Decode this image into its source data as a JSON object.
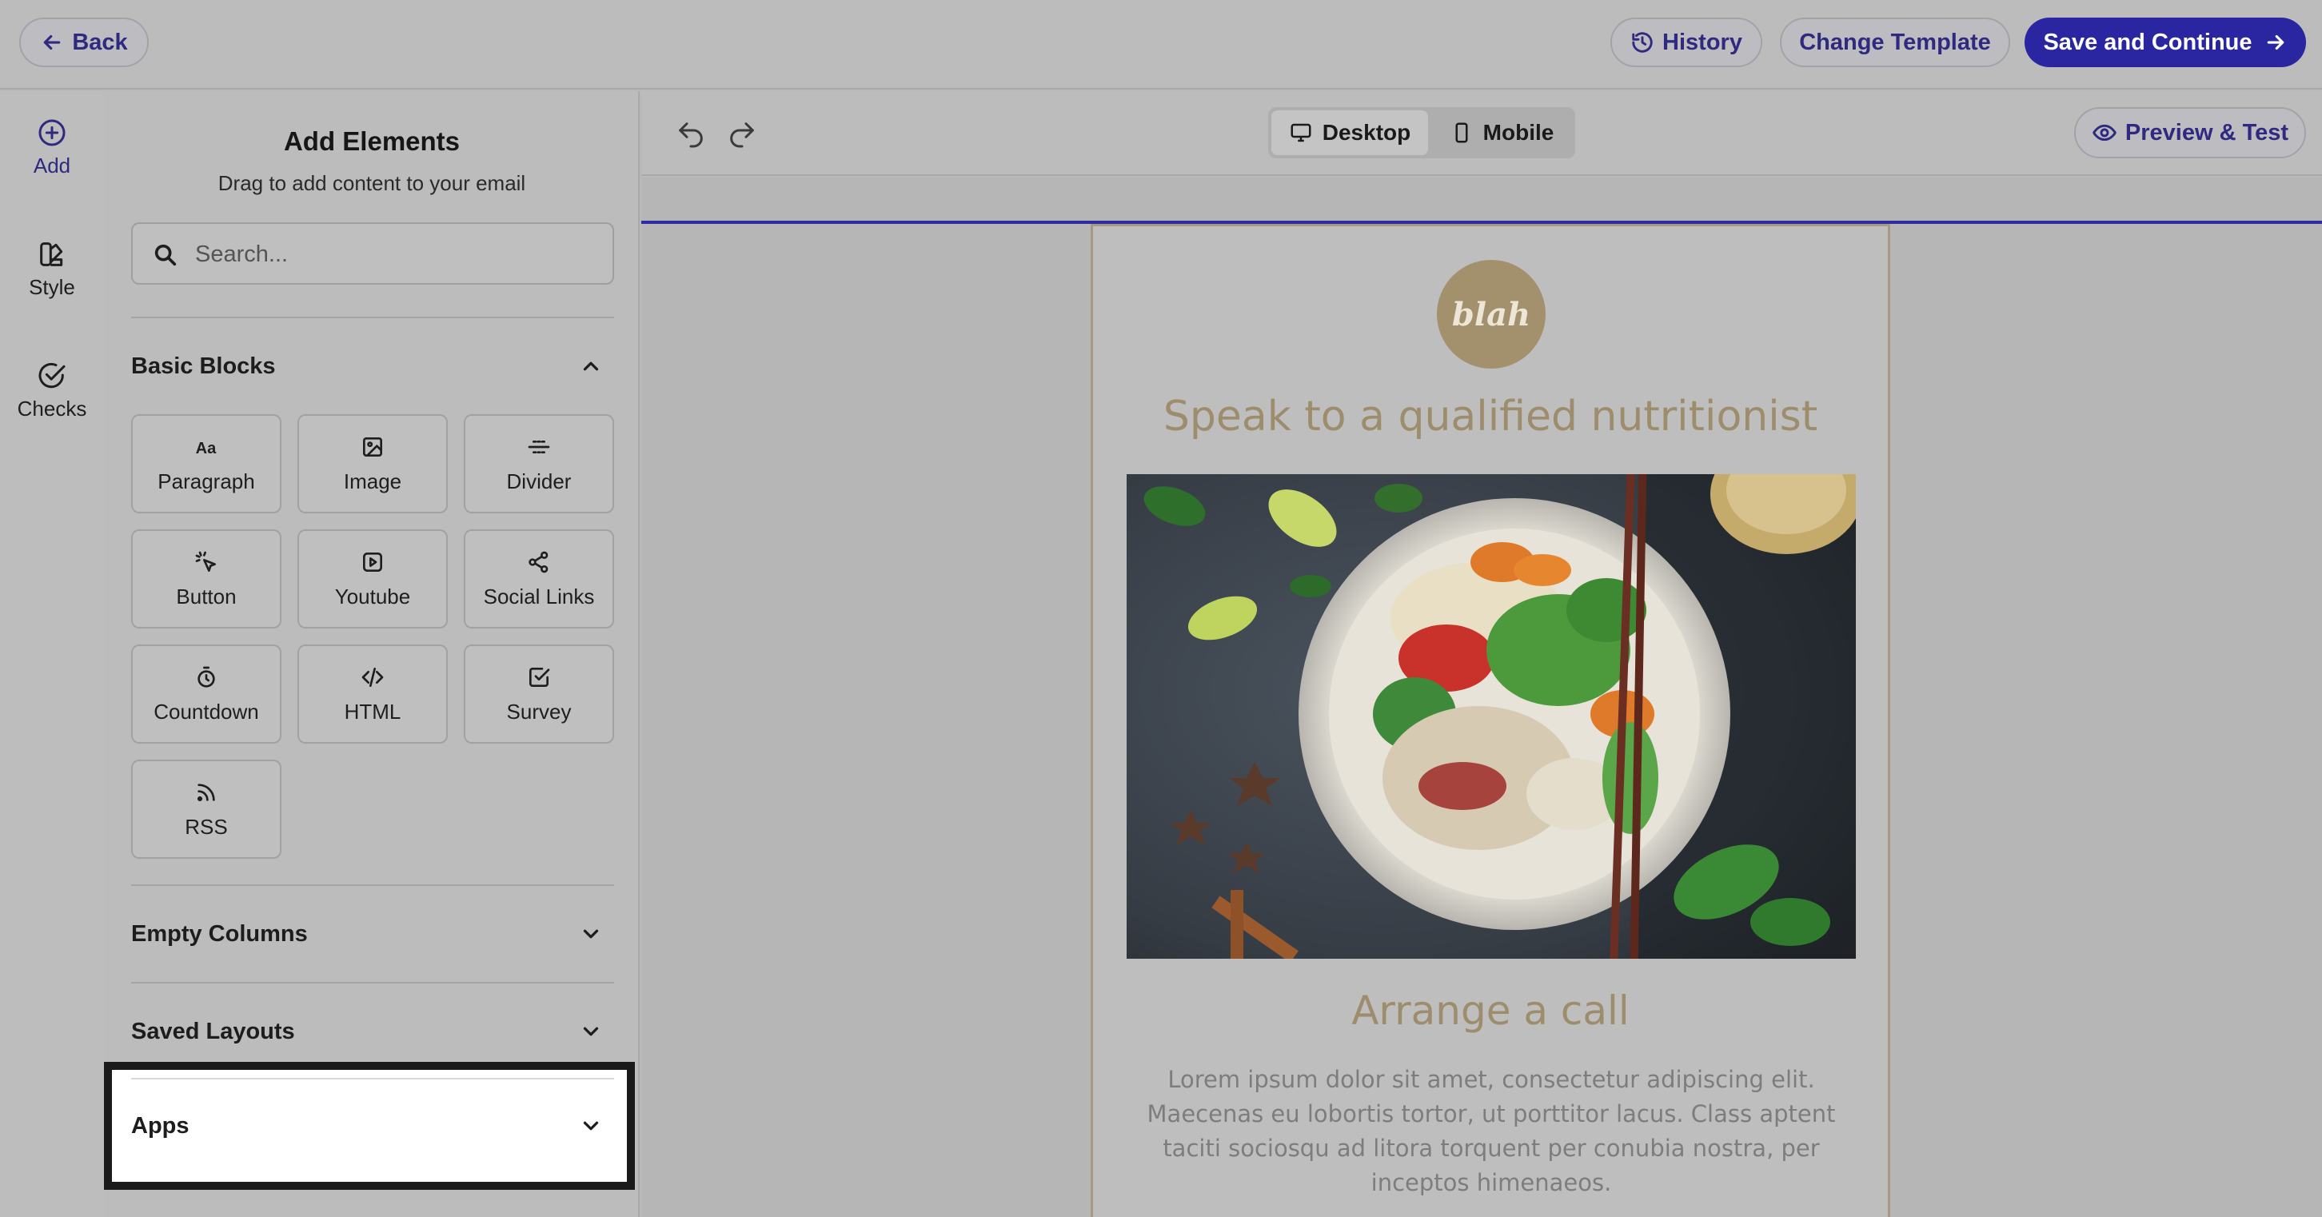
{
  "topbar": {
    "back_label": "Back",
    "history_label": "History",
    "change_template_label": "Change Template",
    "save_continue_label": "Save and Continue"
  },
  "rail": {
    "items": [
      {
        "label": "Add",
        "icon": "plus-circle-icon"
      },
      {
        "label": "Style",
        "icon": "palette-icon"
      },
      {
        "label": "Checks",
        "icon": "check-circle-icon"
      }
    ]
  },
  "panel": {
    "title": "Add Elements",
    "subtitle": "Drag to add content to your email",
    "search_placeholder": "Search...",
    "basic_blocks": {
      "title": "Basic Blocks",
      "tiles": [
        {
          "label": "Paragraph",
          "icon": "text-aa-icon"
        },
        {
          "label": "Image",
          "icon": "image-icon"
        },
        {
          "label": "Divider",
          "icon": "divider-icon"
        },
        {
          "label": "Button",
          "icon": "pointer-click-icon"
        },
        {
          "label": "Youtube",
          "icon": "play-square-icon"
        },
        {
          "label": "Social Links",
          "icon": "share-icon"
        },
        {
          "label": "Countdown",
          "icon": "timer-icon"
        },
        {
          "label": "HTML",
          "icon": "code-icon"
        },
        {
          "label": "Survey",
          "icon": "checkbox-icon"
        },
        {
          "label": "RSS",
          "icon": "rss-icon"
        }
      ]
    },
    "empty_columns_title": "Empty Columns",
    "saved_layouts_title": "Saved Layouts",
    "apps_title": "Apps"
  },
  "canvas_toolbar": {
    "desktop_label": "Desktop",
    "mobile_label": "Mobile",
    "preview_label": "Preview & Test"
  },
  "email": {
    "logo_text": "blah",
    "headline": "Speak to a qualified nutritionist",
    "sub_headline": "Arrange a call",
    "body": "Lorem ipsum dolor sit amet, consectetur adipiscing elit. Maecenas eu lobortis tortor, ut porttitor lacus. Class aptent taciti sociosqu ad litora torquent per conubia nostra, per inceptos himenaeos."
  },
  "colors": {
    "primary": "#2a26a2",
    "accent_text": "#2f2a80",
    "email_heading": "#9e8d6c",
    "logo_bg": "#a3916e"
  }
}
